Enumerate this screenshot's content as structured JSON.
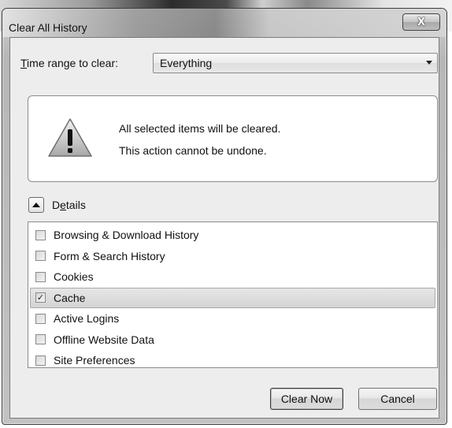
{
  "window": {
    "title": "Clear All History",
    "close_glyph": "X"
  },
  "time_range": {
    "label_accel": "T",
    "label_rest": "ime range to clear:",
    "selected": "Everything"
  },
  "warning": {
    "icon": "warning-triangle-icon",
    "line1": "All selected items will be cleared.",
    "line2": "This action cannot be undone."
  },
  "details": {
    "label_pre": "D",
    "label_accel": "e",
    "label_post": "tails",
    "expanded": true
  },
  "items": [
    {
      "label": "Browsing & Download History",
      "checked": false,
      "mark": ""
    },
    {
      "label": "Form & Search History",
      "checked": false,
      "mark": ""
    },
    {
      "label": "Cookies",
      "checked": false,
      "mark": ""
    },
    {
      "label": "Cache",
      "checked": true,
      "mark": "✓"
    },
    {
      "label": "Active Logins",
      "checked": false,
      "mark": ""
    },
    {
      "label": "Offline Website Data",
      "checked": false,
      "mark": ""
    },
    {
      "label": "Site Preferences",
      "checked": false,
      "mark": ""
    }
  ],
  "buttons": {
    "clear_now": "Clear Now",
    "cancel": "Cancel"
  }
}
